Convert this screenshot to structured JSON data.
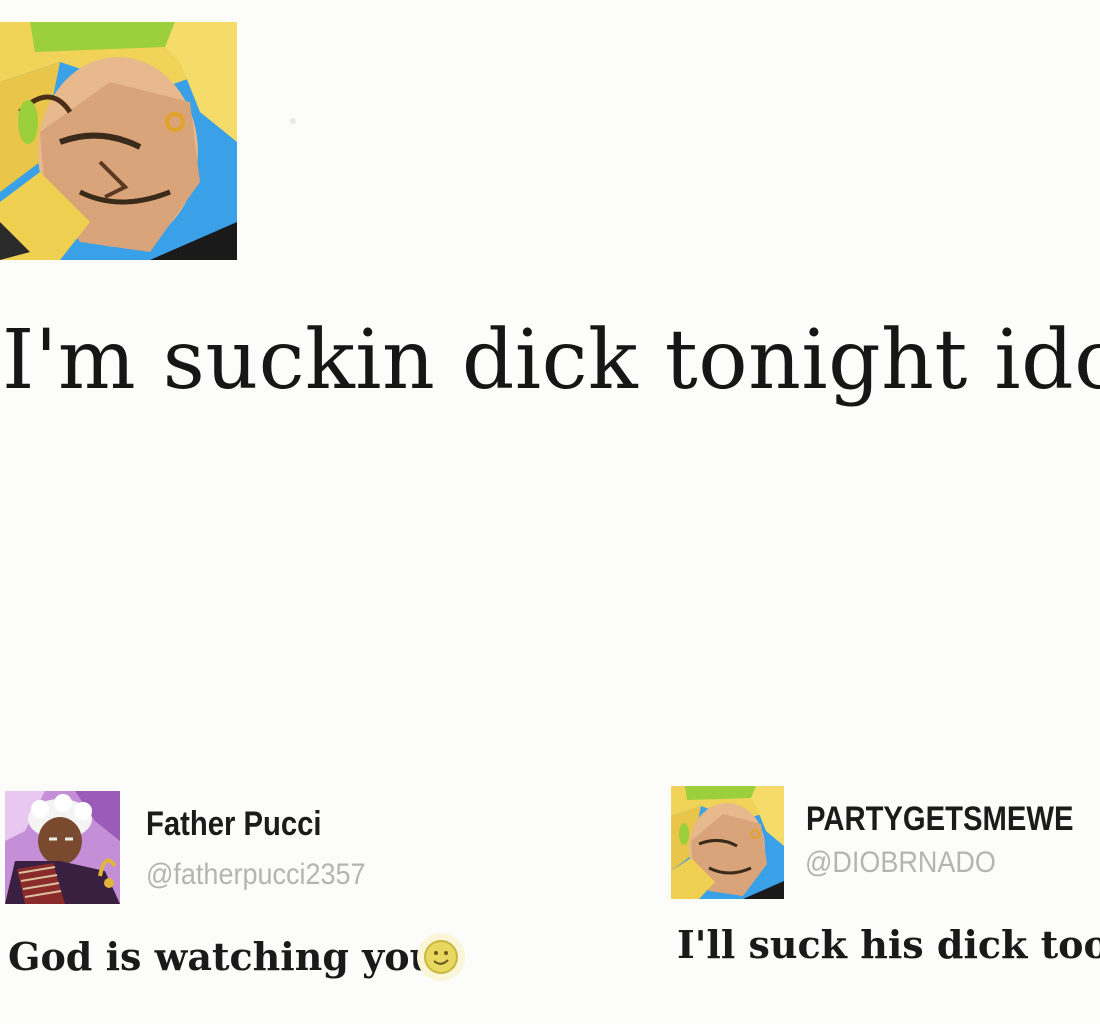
{
  "post": {
    "text": "I'm suckin dick tonight idc",
    "avatar_icon": "dio-portrait-avatar"
  },
  "replies": [
    {
      "display_name": "Father Pucci",
      "handle": "@fatherpucci2357",
      "text": "God is watching you",
      "emoji_icon": "smiling-face-emoji-icon",
      "avatar_icon": "pucci-portrait-avatar"
    },
    {
      "display_name": "PARTYGETSMEWE",
      "handle": "@DIOBRNADO",
      "text": "I'll suck his dick too",
      "avatar_icon": "dio-portrait-avatar"
    }
  ],
  "colors": {
    "background": "#fcfcfa",
    "text": "#161616",
    "handle": "#b4b4b4",
    "avatar_sky": "#3aa0e8",
    "avatar_hair": "#f0d050",
    "avatar_headband": "#8ec63f",
    "emoji_yellow": "#e8d860"
  }
}
